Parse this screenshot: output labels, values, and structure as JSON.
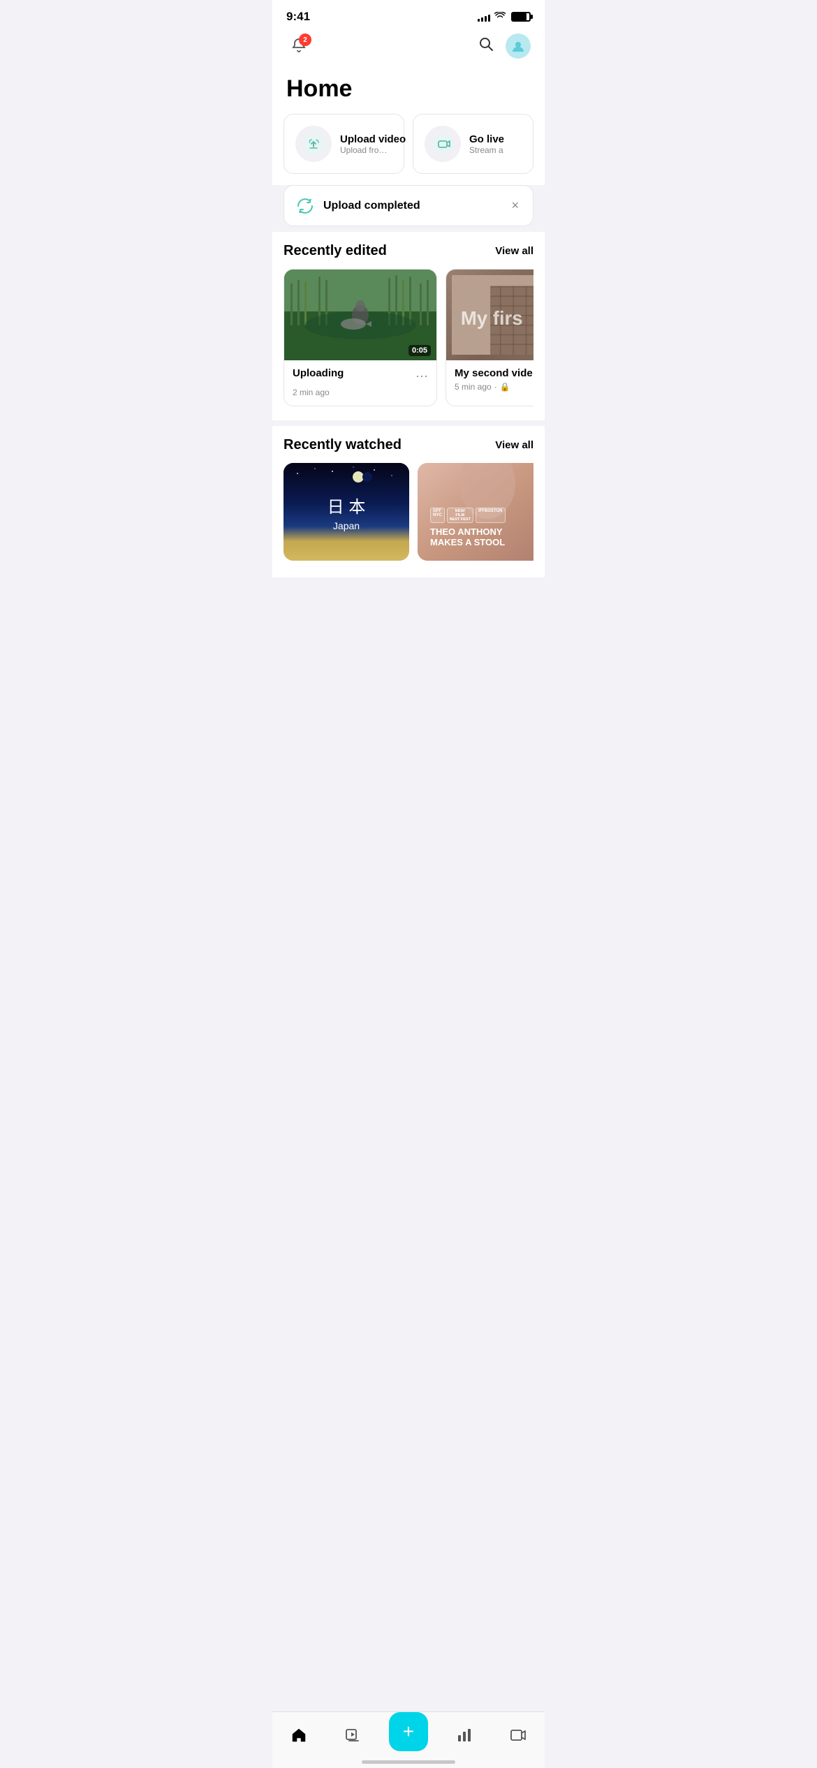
{
  "status_bar": {
    "time": "9:41",
    "signal_bars": [
      4,
      6,
      8,
      10,
      12
    ],
    "battery_level": 85
  },
  "header": {
    "notification_count": "2",
    "page_title": "Home"
  },
  "action_cards": [
    {
      "id": "upload_video",
      "title": "Upload video",
      "subtitle": "Upload from your device",
      "icon": "upload"
    },
    {
      "id": "go_live",
      "title": "Go live",
      "subtitle": "Stream a",
      "icon": "live"
    }
  ],
  "upload_banner": {
    "text": "Upload completed",
    "close_label": "×"
  },
  "recently_edited": {
    "section_title": "Recently edited",
    "view_all_label": "View all",
    "videos": [
      {
        "id": "v1",
        "title": "Uploading",
        "meta": "2 min ago",
        "duration": "0:05",
        "has_more": true,
        "locked": false,
        "thumb_type": "fishing"
      },
      {
        "id": "v2",
        "title": "My second vide",
        "meta": "5 min ago",
        "duration": null,
        "has_more": false,
        "locked": true,
        "thumb_type": "second",
        "thumb_text": "My firs"
      }
    ]
  },
  "recently_watched": {
    "section_title": "Recently watched",
    "view_all_label": "View all",
    "videos": [
      {
        "id": "w1",
        "thumb_type": "japan",
        "kanji": "日 本",
        "roman": "Japan"
      },
      {
        "id": "w2",
        "thumb_type": "stool",
        "badges": [
          "GFF NYC",
          "NEW/ FILM NEXT FEST",
          "IFFBOSTON"
        ],
        "overlay": "THEO ANTHONY\nMAKES A STOOL"
      }
    ]
  },
  "bottom_nav": {
    "items": [
      {
        "id": "home",
        "icon": "⌂",
        "label": "home",
        "active": true
      },
      {
        "id": "library",
        "icon": "▷",
        "label": "library",
        "active": false
      },
      {
        "id": "add",
        "icon": "+",
        "label": "add",
        "is_cta": true
      },
      {
        "id": "analytics",
        "icon": "📊",
        "label": "analytics",
        "active": false
      },
      {
        "id": "watch",
        "icon": "▶",
        "label": "watch",
        "active": false
      }
    ],
    "add_bg_color": "#00d4e8"
  }
}
